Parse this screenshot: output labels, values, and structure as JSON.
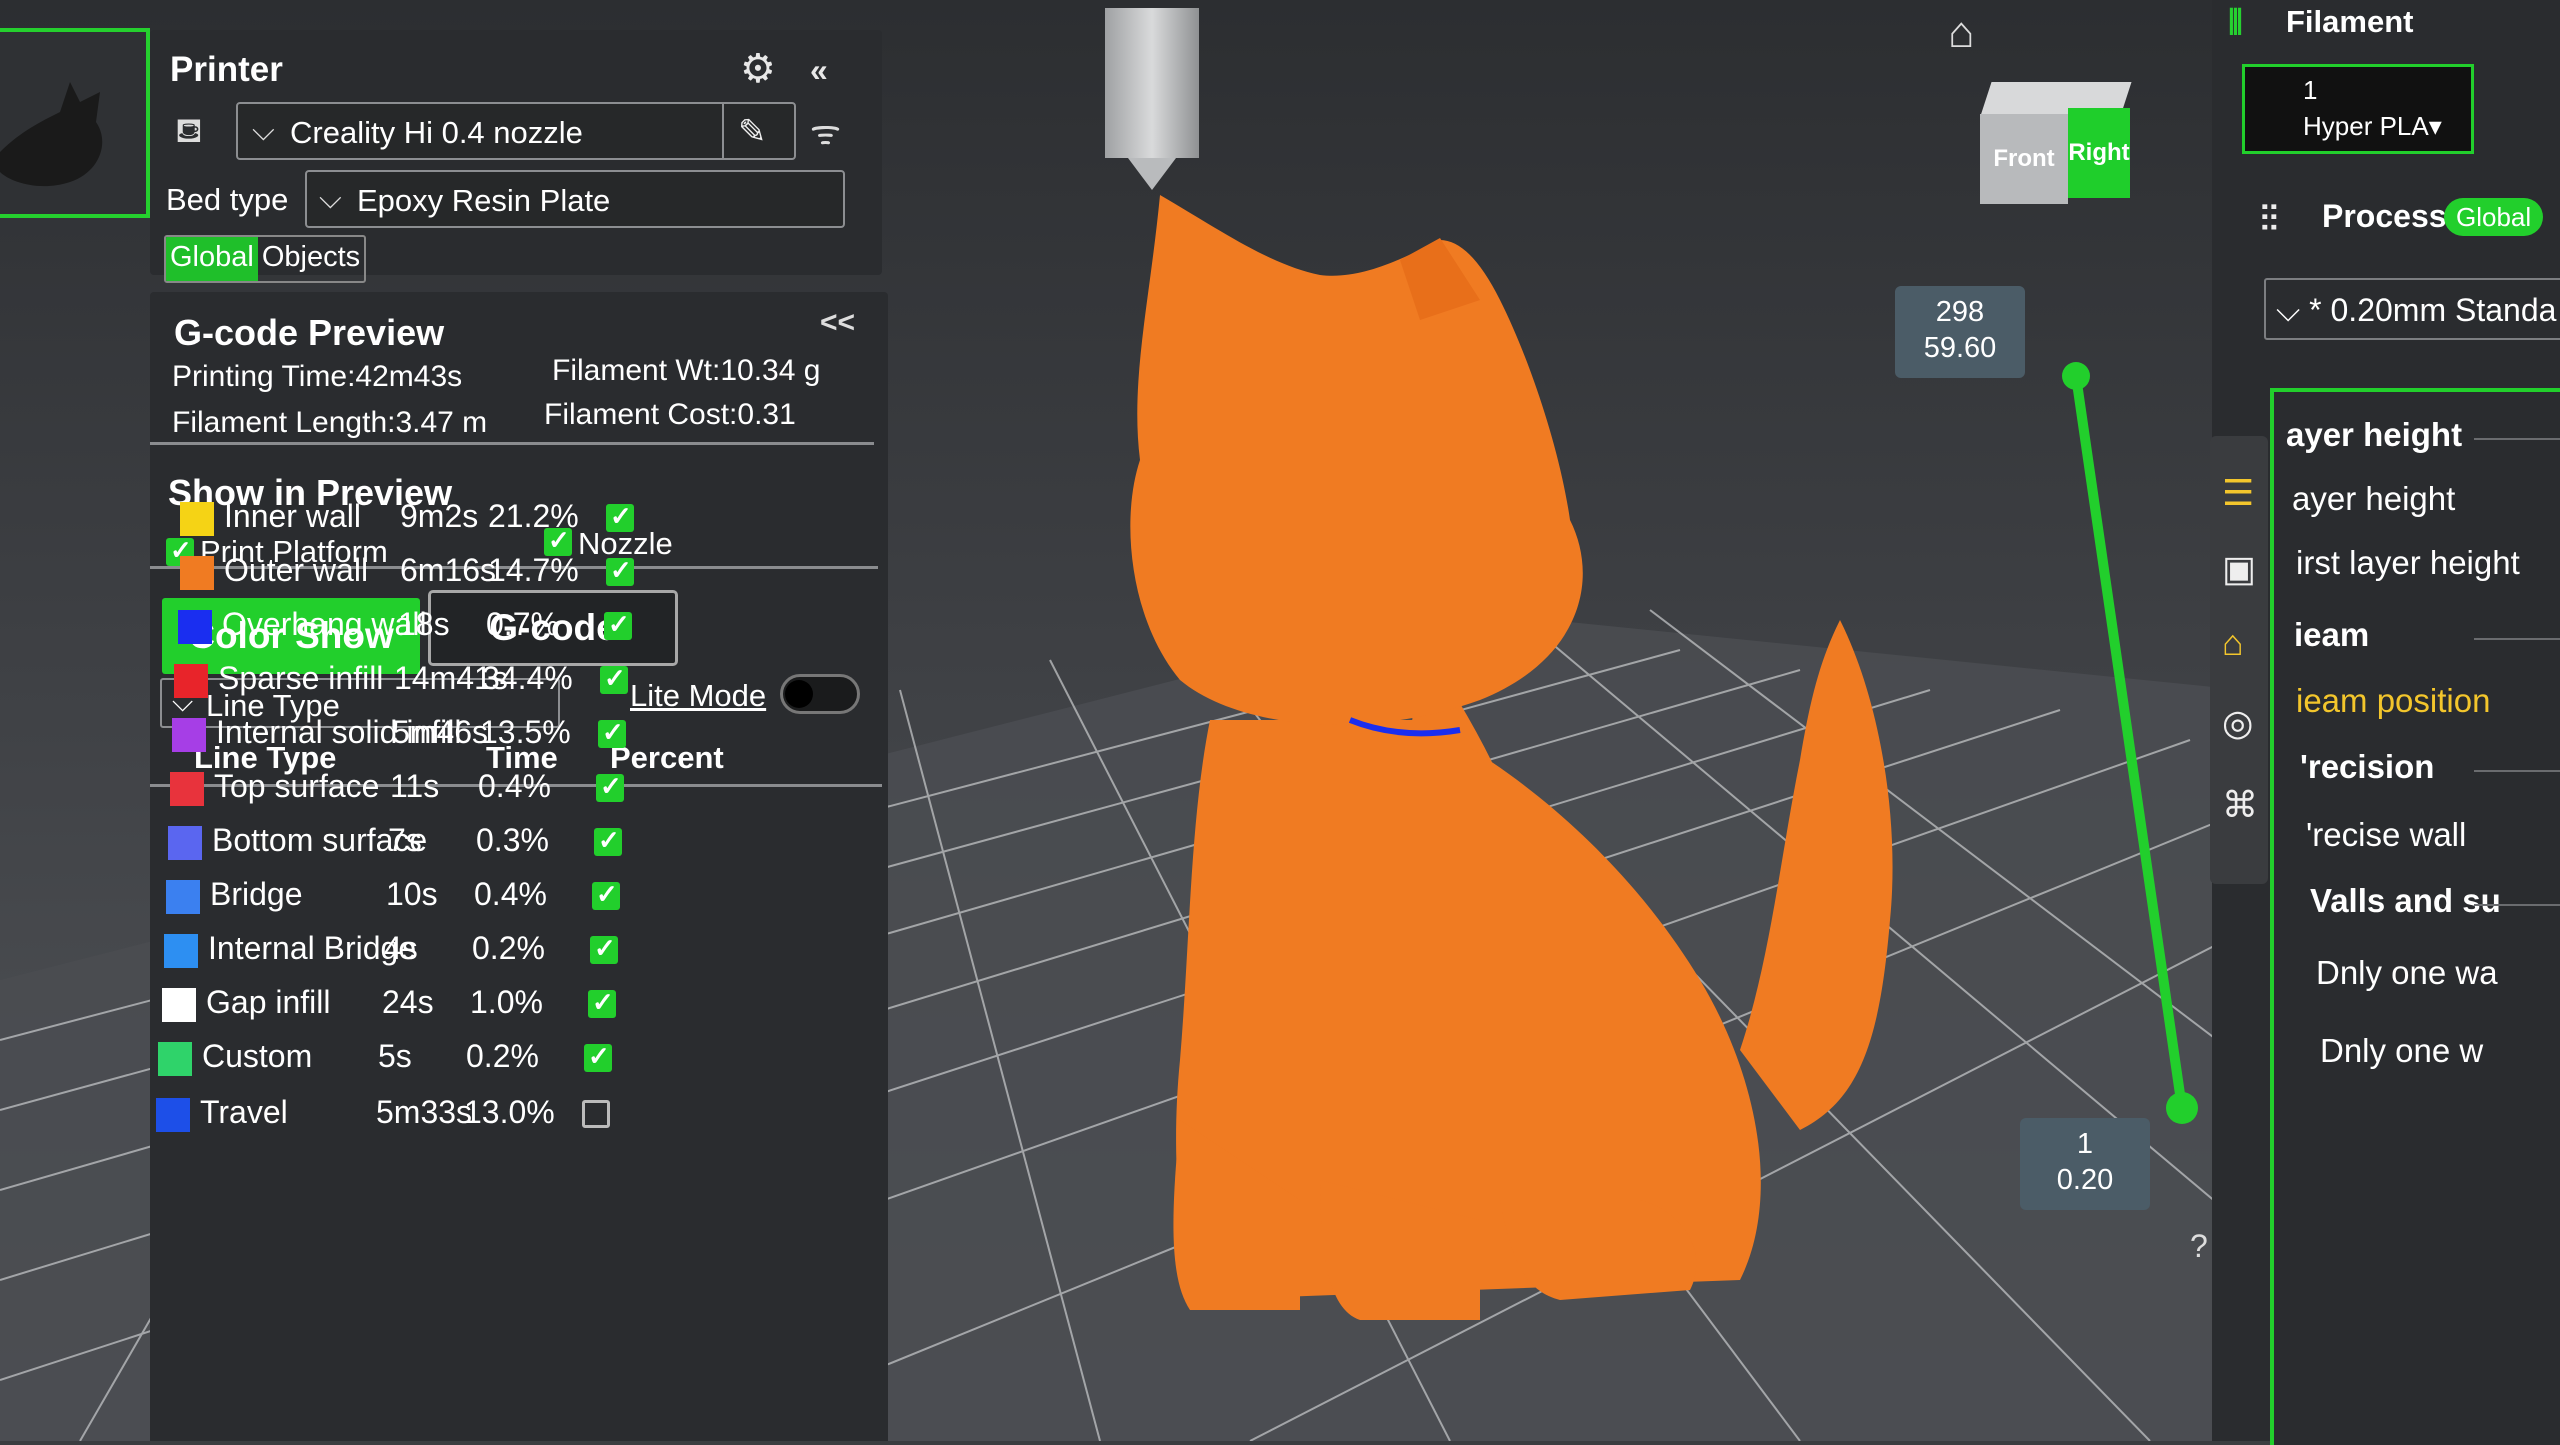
{
  "printer": {
    "title": "Printer",
    "preset": "Creality Hi 0.4 nozzle",
    "bed_label": "Bed type",
    "bed_value": "Epoxy Resin Plate",
    "scope_global": "Global",
    "scope_objects": "Objects",
    "icons": {
      "settings": "gear-icon",
      "collapse": "double-chevron-left-icon",
      "edit": "pencil-icon",
      "wifi": "wifi-icon"
    }
  },
  "gcode": {
    "title": "G-code Preview",
    "collapse": "<<",
    "printing_time": "Printing Time:42m43s",
    "filament_wt": "Filament Wt:10.34 g",
    "filament_length": "Filament Length:3.47 m",
    "filament_cost": "Filament Cost:0.31"
  },
  "show": {
    "title": "Show in Preview",
    "print_platform": "Print Platform",
    "nozzle": "Nozzle",
    "color_show": "Color Show",
    "gcode_btn": "G-code",
    "line_type_select": "Line Type",
    "lite_mode": "Lite Mode",
    "lite_mode_on": false
  },
  "line_table": {
    "headers": [
      "Line Type",
      "Time",
      "Percent"
    ],
    "rows": [
      {
        "name": "Inner wall",
        "time": "9m2s",
        "percent": "21.2%",
        "color": "#f5d315",
        "checked": true
      },
      {
        "name": "Outer wall",
        "time": "6m16s",
        "percent": "14.7%",
        "color": "#f07b22",
        "checked": true
      },
      {
        "name": "Overhang wall",
        "time": "18s",
        "percent": "0.7%",
        "color": "#1a2ef0",
        "checked": true
      },
      {
        "name": "Sparse infill",
        "time": "14m41s",
        "percent": "34.4%",
        "color": "#e8242a",
        "checked": true
      },
      {
        "name": "Internal solid infill",
        "time": "5m46s",
        "percent": "13.5%",
        "color": "#a63ee6",
        "checked": true
      },
      {
        "name": "Top surface",
        "time": "11s",
        "percent": "0.4%",
        "color": "#e8333c",
        "checked": true
      },
      {
        "name": "Bottom surface",
        "time": "7s",
        "percent": "0.3%",
        "color": "#5a66f0",
        "checked": true
      },
      {
        "name": "Bridge",
        "time": "10s",
        "percent": "0.4%",
        "color": "#3b80f0",
        "checked": true
      },
      {
        "name": "Internal Bridge",
        "time": "4s",
        "percent": "0.2%",
        "color": "#2d8ff2",
        "checked": true
      },
      {
        "name": "Gap infill",
        "time": "24s",
        "percent": "1.0%",
        "color": "#ffffff",
        "checked": true
      },
      {
        "name": "Custom",
        "time": "5s",
        "percent": "0.2%",
        "color": "#2fd36a",
        "checked": true
      },
      {
        "name": "Travel",
        "time": "5m33s",
        "percent": "13.0%",
        "color": "#1d4fe8",
        "checked": false
      }
    ]
  },
  "view": {
    "cube_front": "Front",
    "cube_right": "Right",
    "home_icon": "home-icon",
    "layer_top_a": "298",
    "layer_top_b": "59.60",
    "layer_bottom_a": "1",
    "layer_bottom_b": "0.20",
    "help": "?"
  },
  "right": {
    "filament_title": "Filament",
    "filament_slot": "1",
    "filament_type": "Hyper PLA▾",
    "process_title": "Process",
    "process_global": "Global",
    "process_preset": "* 0.20mm Standa",
    "settings": [
      {
        "label": "ayer height",
        "kind": "h"
      },
      {
        "label": "ayer height",
        "kind": ""
      },
      {
        "label": "irst layer height",
        "kind": ""
      },
      {
        "label": "ieam",
        "kind": "h"
      },
      {
        "label": "ieam position",
        "kind": "hl"
      },
      {
        "label": "'recision",
        "kind": "h"
      },
      {
        "label": "'recise wall",
        "kind": ""
      },
      {
        "label": "Valls and su",
        "kind": "h"
      },
      {
        "label": "Dnly one wa",
        "kind": ""
      },
      {
        "label": "Dnly one w",
        "kind": ""
      }
    ]
  },
  "colors": {
    "accent": "#22cf2c",
    "model": "#f07b22",
    "panel": "#2a2c2f",
    "highlight": "#f3c62c"
  }
}
